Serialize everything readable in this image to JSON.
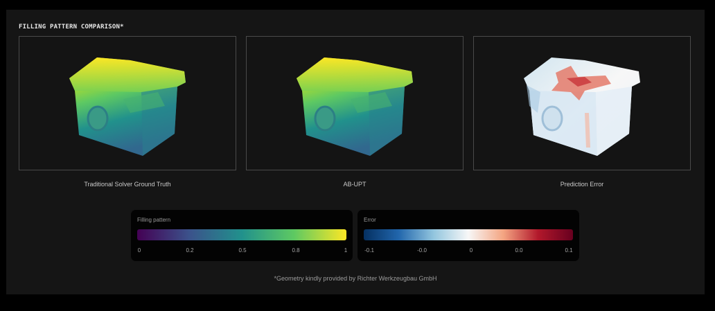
{
  "section_title": "FILLING PATTERN COMPARISON*",
  "panels": [
    {
      "caption": "Traditional Solver Ground Truth",
      "colormap": "viridis"
    },
    {
      "caption": "AB-UPT",
      "colormap": "viridis"
    },
    {
      "caption": "Prediction Error",
      "colormap": "red-blue diverging"
    }
  ],
  "legend_filling": {
    "title": "Filling pattern",
    "ticks": [
      "0",
      "0.2",
      "0.5",
      "0.8",
      "1"
    ],
    "colors": [
      "#440154",
      "#3b528b",
      "#21918c",
      "#5ec962",
      "#fde725"
    ]
  },
  "legend_error": {
    "title": "Error",
    "ticks": [
      "-0.1",
      "-0.0",
      "0",
      "0.0",
      "0.1"
    ],
    "colors": [
      "#053061",
      "#2166ac",
      "#92c5de",
      "#f7f7f7",
      "#f4a582",
      "#b2182b",
      "#67001f"
    ]
  },
  "footnote": "*Geometry kindly provided by Richter Werkzeugbau GmbH"
}
